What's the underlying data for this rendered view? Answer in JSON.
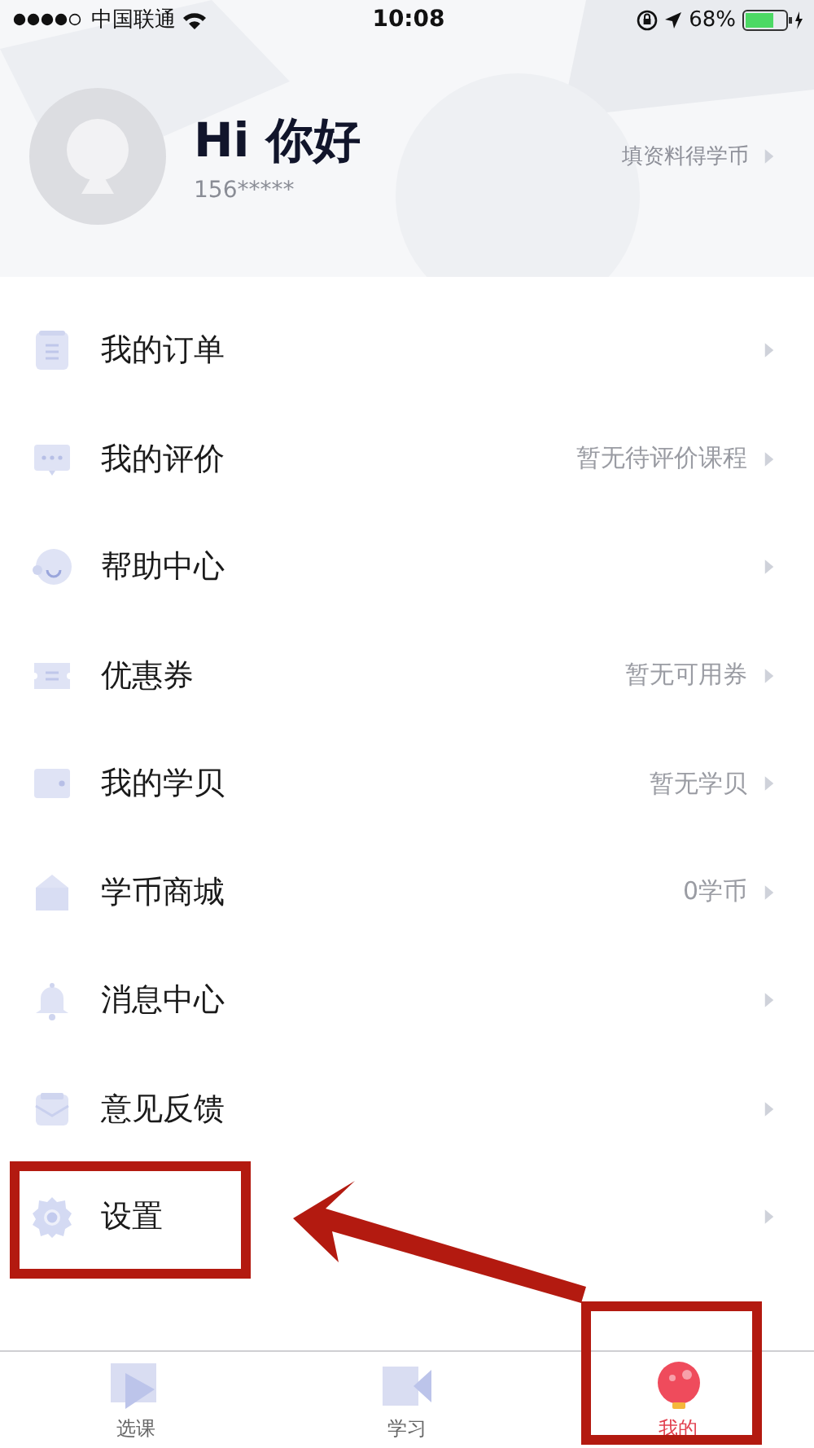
{
  "status_bar": {
    "carrier": "中国联通",
    "time": "10:08",
    "battery": "68%"
  },
  "profile": {
    "greeting": "Hi 你好",
    "phone": "156*****",
    "action": "填资料得学币"
  },
  "menu": [
    {
      "kind": "order",
      "label": "我的订单"
    },
    {
      "kind": "review",
      "label": "我的评价",
      "value": "暂无待评价课程"
    },
    {
      "kind": "help",
      "label": "帮助中心"
    },
    {
      "kind": "coupon",
      "label": "优惠券",
      "value": "暂无可用券"
    },
    {
      "kind": "wallet",
      "label": "我的学贝",
      "value": "暂无学贝"
    },
    {
      "kind": "shop",
      "label": "学币商城",
      "value": "0学币"
    },
    {
      "kind": "bell",
      "label": "消息中心"
    },
    {
      "kind": "mail",
      "label": "意见反馈"
    },
    {
      "kind": "gear",
      "label": "设置"
    }
  ],
  "tabs": [
    {
      "kind": "courses",
      "label": "选课",
      "selected": false
    },
    {
      "kind": "study",
      "label": "学习",
      "selected": false
    },
    {
      "kind": "me",
      "label": "我的",
      "selected": true
    }
  ]
}
